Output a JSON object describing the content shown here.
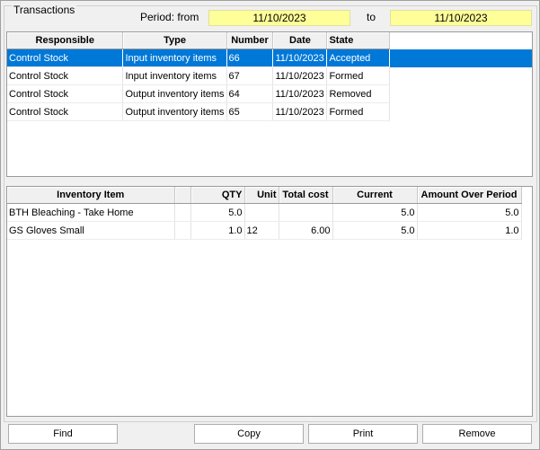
{
  "window": {
    "group_title": "Transactions"
  },
  "period": {
    "from_label": "Period: from",
    "from_value": "11/10/2023",
    "to_label": "to",
    "to_value": "11/10/2023"
  },
  "transactions": {
    "headers": [
      "Responsible",
      "Type",
      "Number",
      "Date",
      "State"
    ],
    "rows": [
      [
        "Control  Stock",
        "Input inventory items",
        "66",
        "11/10/2023",
        "Accepted"
      ],
      [
        "Control  Stock",
        "Input inventory items",
        "67",
        "11/10/2023",
        "Formed"
      ],
      [
        "Control  Stock",
        "Output inventory items",
        "64",
        "11/10/2023",
        "Removed"
      ],
      [
        "Control  Stock",
        "Output inventory items",
        "65",
        "11/10/2023",
        "Formed"
      ]
    ],
    "selected_row": 0
  },
  "items": {
    "headers": [
      "Inventory Item",
      "",
      "QTY",
      "Unit",
      "Total cost",
      "Current",
      "Amount Over Period"
    ],
    "rows": [
      [
        "BTH Bleaching - Take Home",
        "",
        "5.0",
        "",
        "",
        "5.0",
        "5.0"
      ],
      [
        "GS Gloves Small",
        "",
        "1.0",
        "12",
        "6.00",
        "5.0",
        "1.0"
      ]
    ]
  },
  "buttons": {
    "find": "Find",
    "copy": "Copy",
    "print": "Print",
    "remove": "Remove"
  }
}
